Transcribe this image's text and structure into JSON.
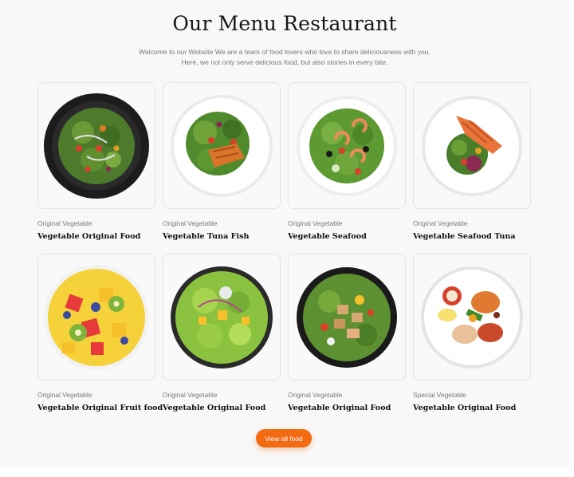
{
  "header": {
    "title": "Our Menu Restaurant",
    "subtitle_line1": "Welcome to our Website We are a team of food lovers who love to share deliciousness with you.",
    "subtitle_line2": "Here, we not only serve delicious food, but also stories in every bite."
  },
  "menu": [
    {
      "category": "Original Vegetable",
      "name": "Vegetable Original Food",
      "image": "mixed-salad-dark-bowl-image"
    },
    {
      "category": "Original Vegetable",
      "name": "Vegetable Tuna Fish",
      "image": "tuna-fish-salad-plate-image"
    },
    {
      "category": "Original Vegetable",
      "name": "Vegetable Seafood",
      "image": "shrimp-seafood-salad-image"
    },
    {
      "category": "Original Vegetable",
      "name": "Vegetable Seafood  Tuna",
      "image": "salmon-salad-plate-image"
    },
    {
      "category": "Original Vegetable",
      "name": "Vegetable Original Fruit food",
      "image": "fruit-salad-bowl-image"
    },
    {
      "category": "Original Vegetable",
      "name": "Vegetable Original Food",
      "image": "green-salad-bowl-image"
    },
    {
      "category": "Original Vegetable",
      "name": "Vegetable Original Food",
      "image": "chicken-salad-dark-bowl-image"
    },
    {
      "category": "Special Vegetable",
      "name": "Vegetable Original Food",
      "image": "meat-platter-plate-image"
    }
  ],
  "actions": {
    "view_all_label": "View all food"
  },
  "colors": {
    "accent": "#f26a12",
    "background": "#f8f8f8",
    "card_border": "#e3e3e3"
  }
}
